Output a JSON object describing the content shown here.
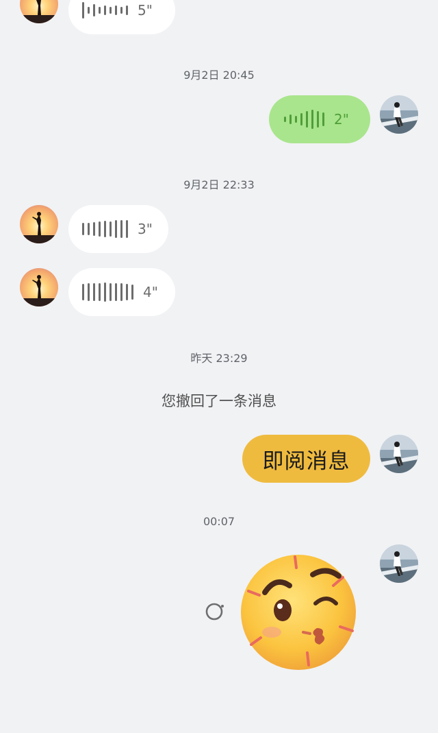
{
  "messages": {
    "m1": {
      "duration": "5\""
    },
    "t1": "9月2日 20:45",
    "m2": {
      "duration": "2\""
    },
    "t2": "9月2日 22:33",
    "m3": {
      "duration": "3\""
    },
    "m4": {
      "duration": "4\""
    },
    "t3": "昨天 23:29",
    "recall_notice": "您撤回了一条消息",
    "m5": {
      "text": "即阅消息"
    },
    "t4": "00:07",
    "m6": {
      "sticker": "kiss-wink-emoji-icon"
    }
  },
  "colors": {
    "background": "#f1f2f4",
    "incoming_bubble": "#ffffff",
    "outgoing_voice_bubble": "#a9e58c",
    "outgoing_text_bubble": "#efbb3f"
  }
}
